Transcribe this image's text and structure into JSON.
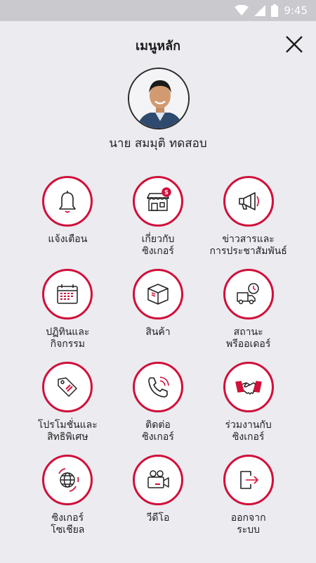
{
  "status_bar": {
    "time": "9:45",
    "icons": [
      "wifi-icon",
      "signal-icon",
      "battery-icon"
    ]
  },
  "header": {
    "title": "เมนูหลัก",
    "close_icon": "close-icon"
  },
  "user": {
    "name": "นาย สมมุติ ทดสอบ"
  },
  "colors": {
    "accent": "#d0103a",
    "background": "#ebebf0",
    "status_bar": "#c9c9ce"
  },
  "menu": [
    {
      "label": "แจ้งเตือน",
      "icon": "bell-icon"
    },
    {
      "label": "เกี่ยวกับ\nซิงเกอร์",
      "icon": "store-icon"
    },
    {
      "label": "ข่าวสารและ\nการประชาสัมพันธ์",
      "icon": "megaphone-icon"
    },
    {
      "label": "ปฏิทินและ\nกิจกรรม",
      "icon": "calendar-icon"
    },
    {
      "label": "สินค้า",
      "icon": "box-icon"
    },
    {
      "label": "สถานะ\nพรีออเดอร์",
      "icon": "delivery-truck-icon"
    },
    {
      "label": "โปรโมชั่นและ\nสิทธิพิเศษ",
      "icon": "price-tag-icon"
    },
    {
      "label": "ติดต่อ\nซิงเกอร์",
      "icon": "phone-icon"
    },
    {
      "label": "ร่วมงานกับ\nซิงเกอร์",
      "icon": "handshake-icon"
    },
    {
      "label": "ซิงเกอร์\nโซเชียล",
      "icon": "globe-icon"
    },
    {
      "label": "วีดีโอ",
      "icon": "video-camera-icon"
    },
    {
      "label": "ออกจาก\nระบบ",
      "icon": "logout-icon"
    }
  ]
}
